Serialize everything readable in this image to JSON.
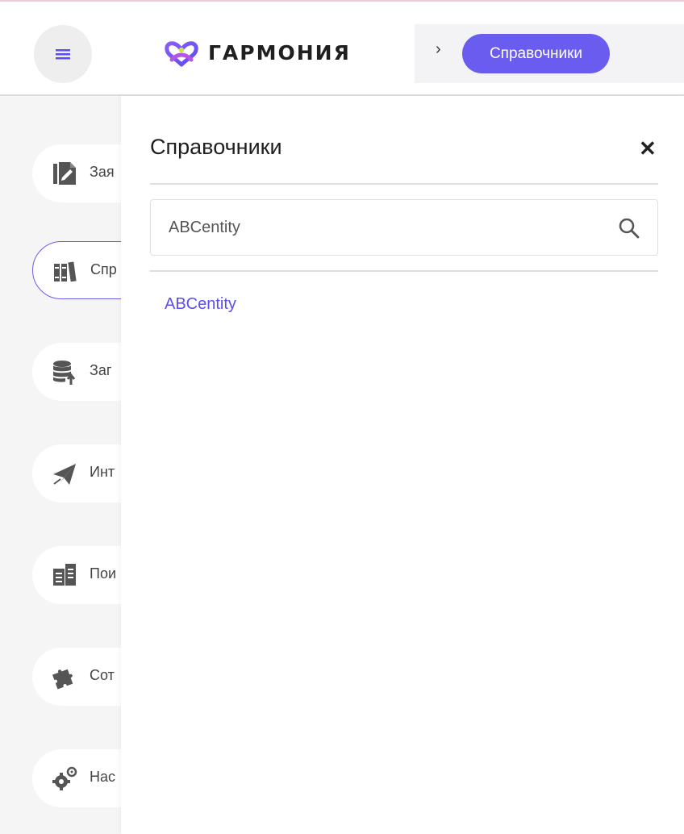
{
  "header": {
    "logo_text": "ГАРМОНИЯ",
    "breadcrumb_separator": "›",
    "breadcrumb_active": "Справочники"
  },
  "sidebar": {
    "items": [
      {
        "icon": "document-edit-icon",
        "label": "Зая"
      },
      {
        "icon": "books-icon",
        "label": "Спр",
        "active": true
      },
      {
        "icon": "database-upload-icon",
        "label": "Заг"
      },
      {
        "icon": "paper-plane-icon",
        "label": "Инт"
      },
      {
        "icon": "documents-icon",
        "label": "Пои"
      },
      {
        "icon": "puzzle-icon",
        "label": "Сот"
      },
      {
        "icon": "gears-icon",
        "label": "Нас"
      }
    ]
  },
  "panel": {
    "title": "Справочники",
    "close_symbol": "✕",
    "search": {
      "value": "ABCentity",
      "placeholder": "ABCentity"
    },
    "results": [
      "ABCentity"
    ]
  },
  "colors": {
    "accent": "#6b5cf0",
    "link": "#5b4ef0",
    "sidebar_bg": "#f5f5f5",
    "icon_gray": "#555555"
  }
}
